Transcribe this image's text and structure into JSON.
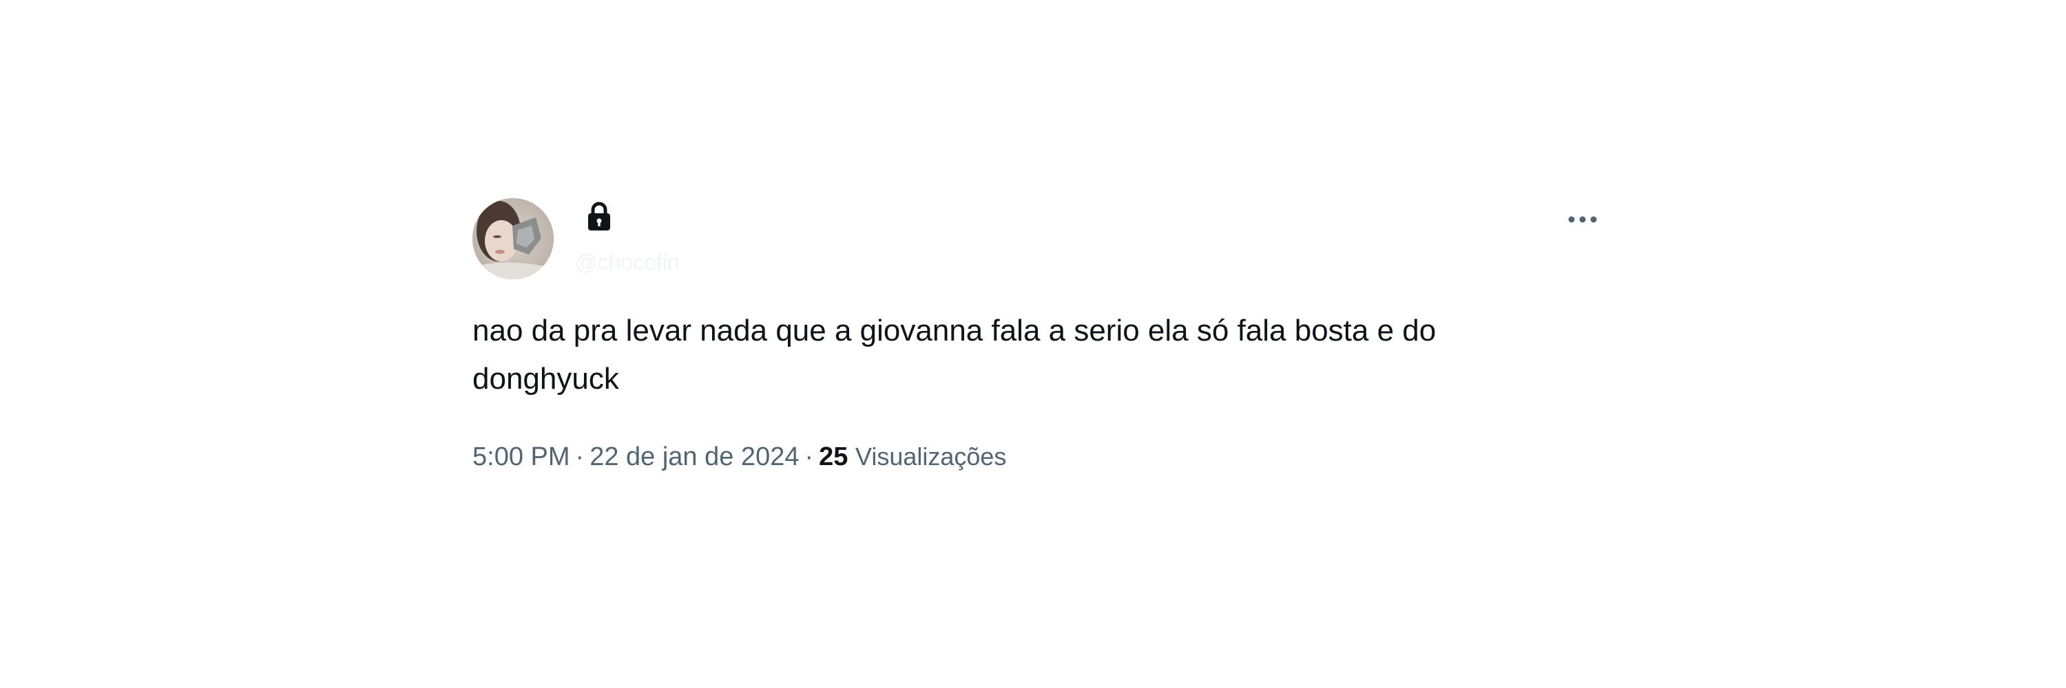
{
  "tweet": {
    "handle": "@chocofin",
    "text_lines": [
      "nao da pra levar nada que a giovanna fala a serio ela só fala bosta e do",
      "donghyuck"
    ],
    "time": "5:00 PM",
    "separator": "·",
    "date": "22 de jan de 2024",
    "views_count": "25",
    "views_label": "Visualizações"
  },
  "icons": {
    "lock": "lock-icon",
    "more": "more-options-icon"
  },
  "colors": {
    "text": "#0f1419",
    "meta_text": "#536471",
    "handle_text": "#f2f3f4",
    "background": "#ffffff"
  }
}
